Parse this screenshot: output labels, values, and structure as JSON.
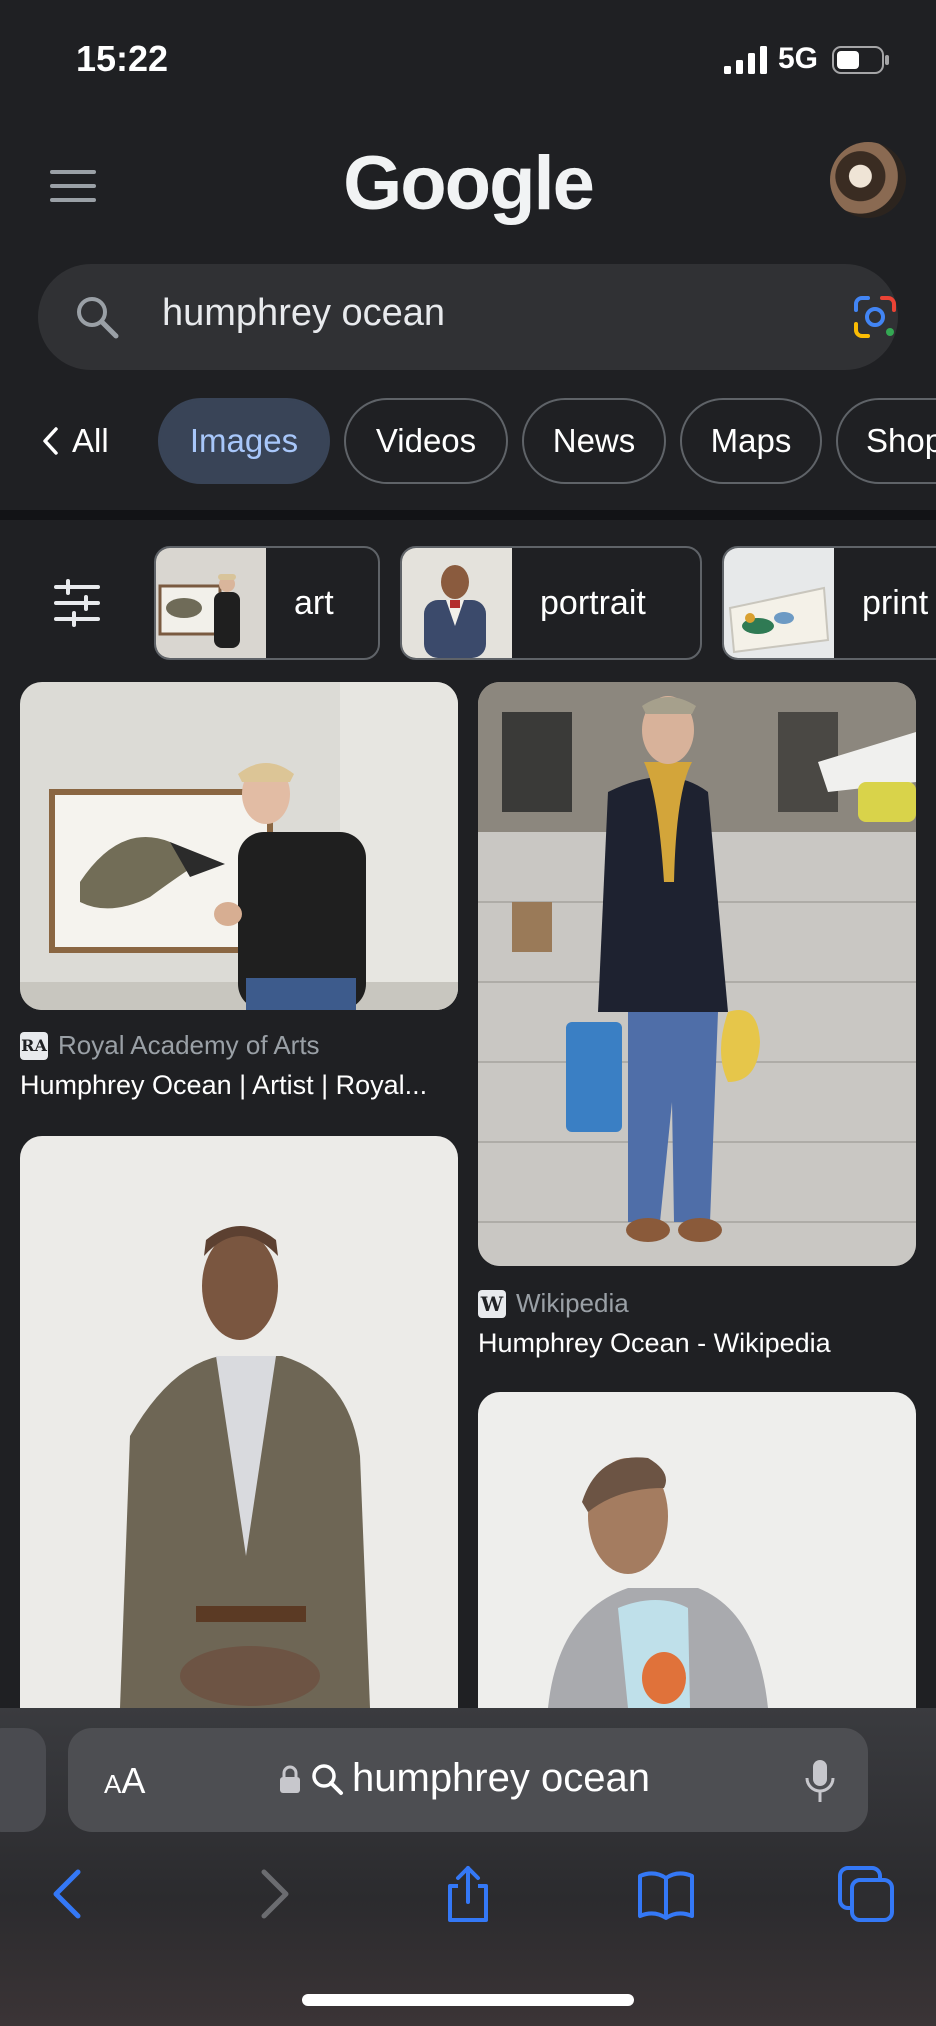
{
  "status_bar": {
    "time": "15:22",
    "network": "5G"
  },
  "header": {
    "logo": "Google"
  },
  "search": {
    "query": "humphrey ocean"
  },
  "tabs": [
    {
      "label": "All"
    },
    {
      "label": "Images",
      "active": true
    },
    {
      "label": "Videos"
    },
    {
      "label": "News"
    },
    {
      "label": "Maps"
    },
    {
      "label": "Shop"
    }
  ],
  "chips": [
    {
      "label": "art"
    },
    {
      "label": "portrait"
    },
    {
      "label": "print"
    }
  ],
  "results": [
    {
      "source": "Royal Academy of Arts",
      "favicon": "RA",
      "title": "Humphrey Ocean | Artist | Royal..."
    },
    {
      "source": "Wikipedia",
      "favicon": "W",
      "title": "Humphrey Ocean - Wikipedia"
    }
  ],
  "browser": {
    "text_size_label_small": "A",
    "text_size_label_large": "A",
    "url_text": "humphrey ocean"
  },
  "colors": {
    "background": "#1f2023",
    "active_tab_bg": "#394457",
    "active_tab_text": "#a8c7fa",
    "ios_blue": "#3478f6"
  }
}
